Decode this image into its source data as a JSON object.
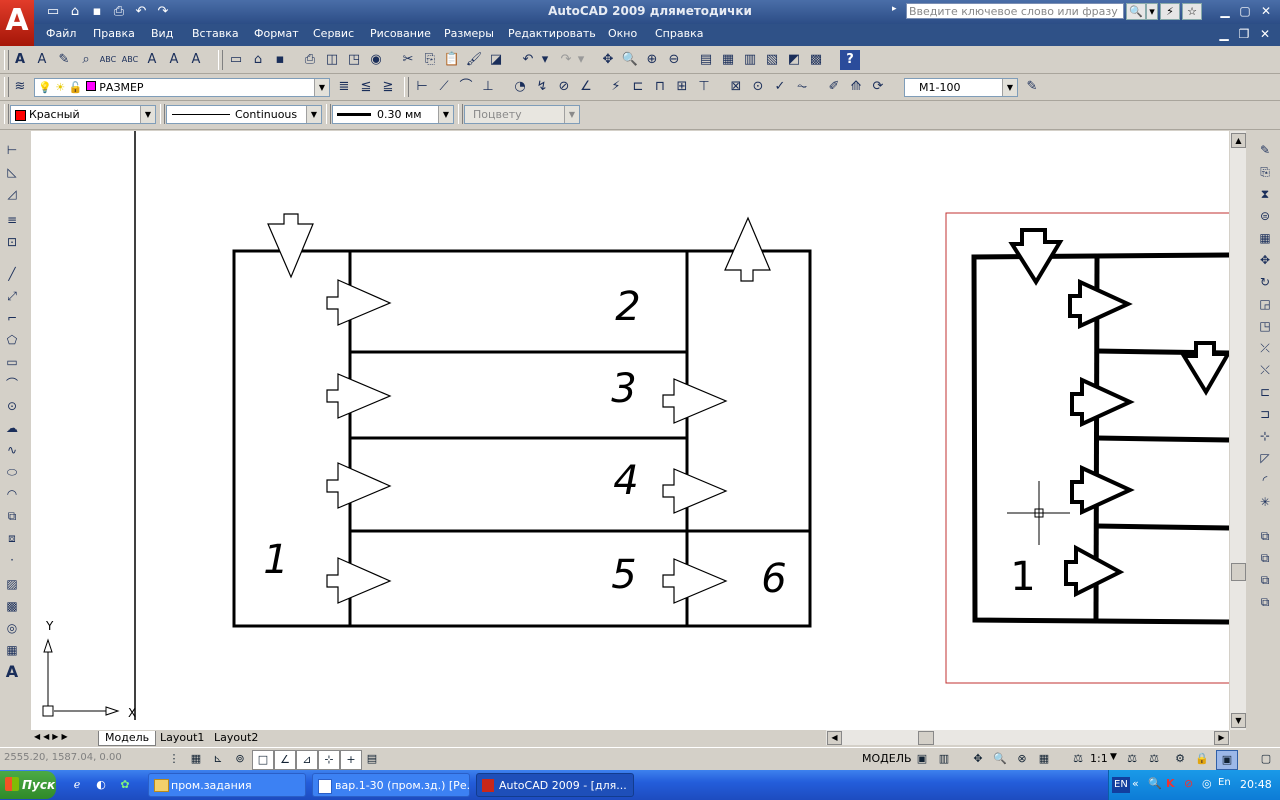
{
  "window": {
    "title": "AutoCAD 2009  дляметодички",
    "search_placeholder": "Введите ключевое слово или фразу"
  },
  "menu": [
    "Файл",
    "Правка",
    "Вид",
    "Вставка",
    "Формат",
    "Сервис",
    "Рисование",
    "Размеры",
    "Редактировать",
    "Окно",
    "Справка"
  ],
  "layers": {
    "current_layer": "РАЗМЕР",
    "dimstyle": "М1-100"
  },
  "properties": {
    "color": "Красный",
    "linetype": "Continuous",
    "lineweight": "0.30 мм",
    "plotstyle": "Поцвету"
  },
  "drawing": {
    "labels": {
      "c1": "1",
      "c2": "2",
      "c3": "3",
      "c4": "4",
      "c5": "5",
      "c6": "6"
    },
    "axis_labels": {
      "y": "Y",
      "x": "X"
    },
    "image_label": "1"
  },
  "layout_tabs": [
    "Модель",
    "Layout1",
    "Layout2"
  ],
  "status": {
    "model_label": "МОДЕЛЬ",
    "scale": "1:1",
    "coords": "2555.20, 1587.04, 0.00"
  },
  "taskbar": {
    "start": "Пуск",
    "tasks": [
      "пром.задания",
      "вар.1-30 (пром.зд.) [Ре...",
      "AutoCAD 2009 - [для..."
    ],
    "lang": "EN",
    "clock": "20:48"
  }
}
